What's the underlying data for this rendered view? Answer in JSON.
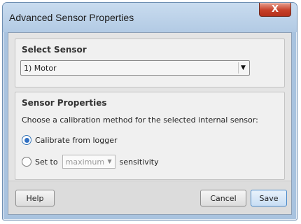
{
  "window": {
    "title": "Advanced Sensor Properties",
    "close_glyph": "X"
  },
  "select_sensor": {
    "heading": "Select Sensor",
    "selected": "1) Motor",
    "arrow_icon": "chevron-down-icon"
  },
  "sensor_properties": {
    "heading": "Sensor Properties",
    "instruction": "Choose a calibration method for the selected internal sensor:",
    "options": [
      {
        "label": "Calibrate from logger",
        "selected": true
      },
      {
        "label_before": "Set to",
        "dropdown_value": "maximum",
        "label_after": "sensitivity",
        "selected": false
      }
    ]
  },
  "footer": {
    "help_label": "Help",
    "cancel_label": "Cancel",
    "save_label": "Save"
  },
  "colors": {
    "title_bar": "#b2cae4",
    "close_button": "#c7412a",
    "radio_selected": "#2f6fc3",
    "save_border": "#4b8ac9"
  }
}
